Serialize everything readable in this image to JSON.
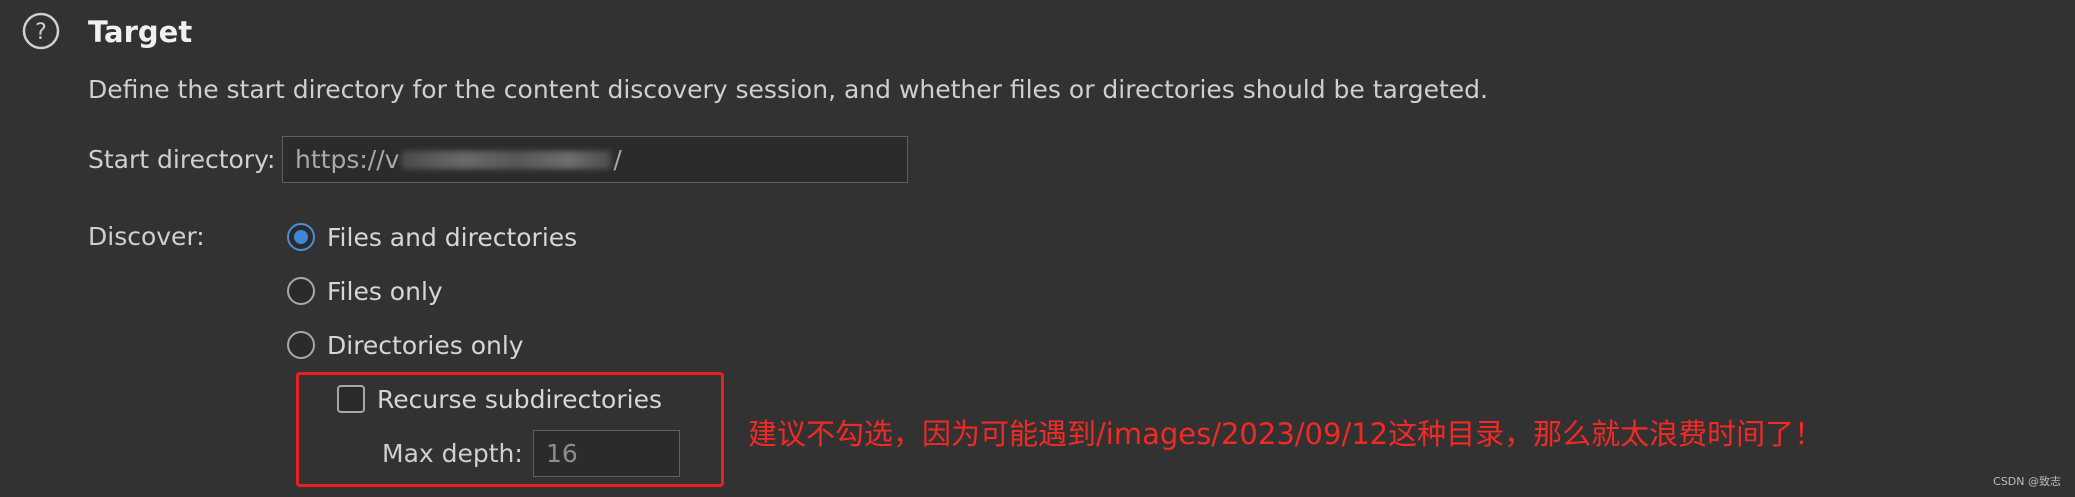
{
  "section": {
    "title": "Target",
    "icon": "help-circle-icon",
    "description": "Define the start directory for the content discovery session, and whether files or directories should be targeted."
  },
  "start_directory": {
    "label": "Start directory:",
    "value_prefix": "https://v",
    "value_suffix": "/"
  },
  "discover": {
    "label": "Discover:",
    "options": [
      {
        "label": "Files and directories",
        "selected": true
      },
      {
        "label": "Files only",
        "selected": false
      },
      {
        "label": "Directories only",
        "selected": false
      }
    ]
  },
  "recurse": {
    "label": "Recurse subdirectories",
    "checked": false
  },
  "max_depth": {
    "label": "Max depth:",
    "value": "16"
  },
  "annotation": {
    "text": "建议不勾选，因为可能遇到/images/2023/09/12这种目录，那么就太浪费时间了！",
    "color": "#f02a24"
  },
  "watermark": "CSDN @致志",
  "colors": {
    "background": "#323232",
    "accent": "#3f86d6",
    "highlight_border": "#e8201f"
  }
}
